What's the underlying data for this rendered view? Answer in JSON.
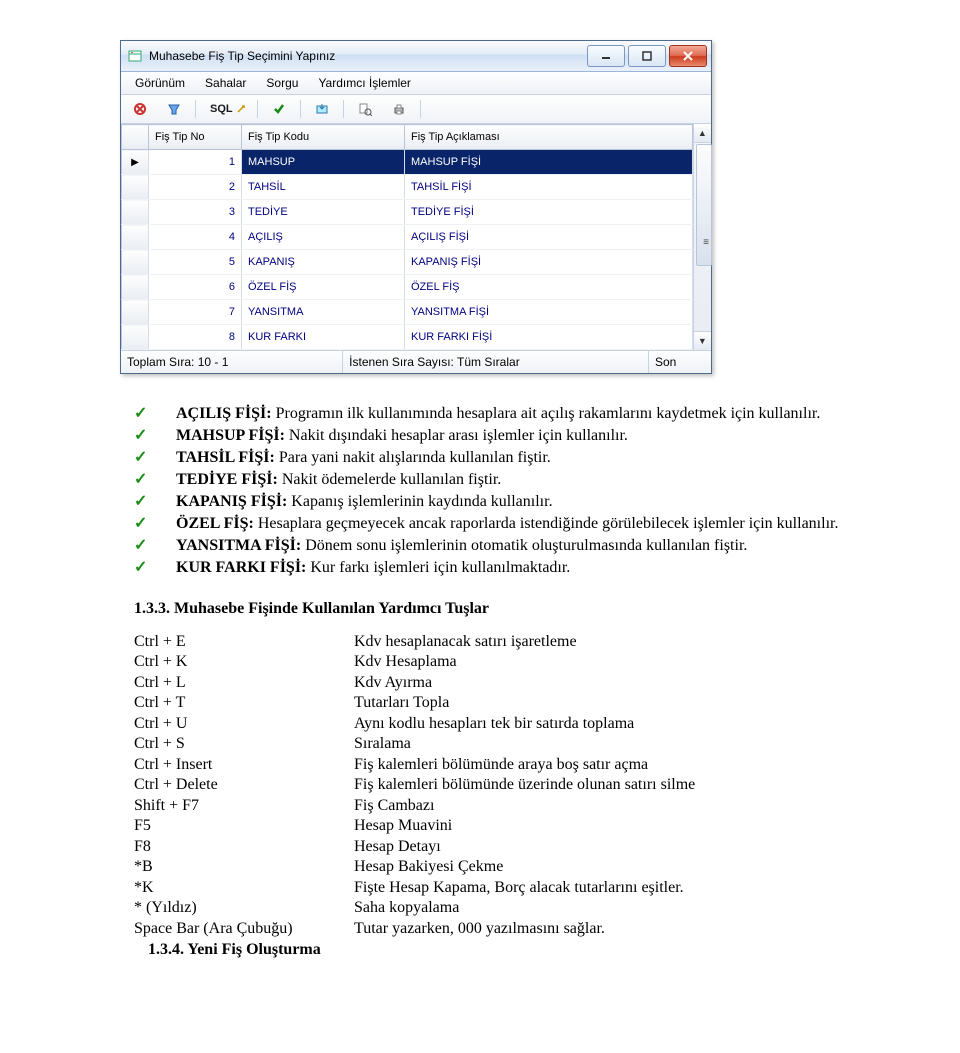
{
  "window": {
    "title": "Muhasebe Fiş Tip Seçimini Yapınız",
    "menu": [
      "Görünüm",
      "Sahalar",
      "Sorgu",
      "Yardımcı İşlemler"
    ],
    "toolbar_sql": "SQL",
    "columns": {
      "no": "Fiş Tip No",
      "kod": "Fiş Tip Kodu",
      "acik": "Fiş Tip Açıklaması"
    },
    "rows": [
      {
        "no": "1",
        "kod": "MAHSUP",
        "acik": "MAHSUP FİŞİ"
      },
      {
        "no": "2",
        "kod": "TAHSİL",
        "acik": "TAHSİL FİŞİ"
      },
      {
        "no": "3",
        "kod": "TEDİYE",
        "acik": "TEDİYE FİŞİ"
      },
      {
        "no": "4",
        "kod": "AÇILIŞ",
        "acik": "AÇILIŞ FİŞİ"
      },
      {
        "no": "5",
        "kod": "KAPANIŞ",
        "acik": "KAPANIŞ FİŞİ"
      },
      {
        "no": "6",
        "kod": "ÖZEL FİŞ",
        "acik": "ÖZEL FİŞ"
      },
      {
        "no": "7",
        "kod": "YANSITMA",
        "acik": "YANSITMA FİŞİ"
      },
      {
        "no": "8",
        "kod": "KUR FARKI",
        "acik": "KUR FARKI FİŞİ"
      }
    ],
    "statusbar": {
      "left": "Toplam Sıra: 10 - 1",
      "mid": "İstenen Sıra Sayısı: Tüm Sıralar",
      "right": "Son"
    }
  },
  "bullets": {
    "b1_head": "AÇILIŞ FİŞİ:",
    "b1_text": " Programın ilk kullanımında hesaplara ait açılış rakamlarını kaydetmek için kullanılır.",
    "b2_head": "MAHSUP FİŞİ:",
    "b2_text": " Nakit dışındaki hesaplar arası işlemler için kullanılır.",
    "b3_head": "TAHSİL FİŞİ:",
    "b3_text": " Para yani nakit alışlarında kullanılan fiştir.",
    "b4_head": "TEDİYE FİŞİ:",
    "b4_text": " Nakit ödemelerde kullanılan fiştir.",
    "b5_head": "KAPANIŞ FİŞİ:",
    "b5_text": " Kapanış işlemlerinin kaydında kullanılır.",
    "b6_head": "ÖZEL FİŞ:",
    "b6_text": " Hesaplara geçmeyecek ancak raporlarda istendiğinde görülebilecek işlemler için kullanılır.",
    "b7_head": "YANSITMA FİŞİ:",
    "b7_text": " Dönem sonu işlemlerinin otomatik oluşturulmasında kullanılan fiştir.",
    "b8_head": "KUR FARKI FİŞİ:",
    "b8_text": " Kur farkı işlemleri için kullanılmaktadır."
  },
  "heading133": "1.3.3. Muhasebe Fişinde Kullanılan Yardımcı Tuşlar",
  "kb": [
    {
      "k": "Ctrl + E",
      "d": "Kdv hesaplanacak satırı işaretleme"
    },
    {
      "k": "Ctrl + K",
      "d": "Kdv Hesaplama"
    },
    {
      "k": "Ctrl + L",
      "d": "Kdv Ayırma"
    },
    {
      "k": "Ctrl + T",
      "d": "Tutarları Topla"
    },
    {
      "k": "Ctrl + U",
      "d": "Aynı kodlu hesapları tek bir satırda toplama"
    },
    {
      "k": "Ctrl + S",
      "d": "Sıralama"
    },
    {
      "k": "Ctrl + Insert",
      "d": "Fiş kalemleri bölümünde araya boş satır açma"
    },
    {
      "k": "Ctrl + Delete",
      "d": "Fiş kalemleri bölümünde üzerinde olunan satırı silme"
    },
    {
      "k": "Shift + F7",
      "d": "Fiş Cambazı"
    },
    {
      "k": "F5",
      "d": "Hesap Muavini"
    },
    {
      "k": "F8",
      "d": "Hesap Detayı"
    },
    {
      "k": "*B",
      "d": "Hesap Bakiyesi Çekme"
    },
    {
      "k": "*K",
      "d": "Fişte Hesap Kapama, Borç alacak tutarlarını eşitler."
    },
    {
      "k": " * (Yıldız)",
      "d": "Saha kopyalama"
    },
    {
      "k": "Space Bar (Ara Çubuğu)",
      "d": "Tutar yazarken, 000 yazılmasını sağlar."
    }
  ],
  "heading134": "1.3.4. Yeni Fiş Oluşturma"
}
